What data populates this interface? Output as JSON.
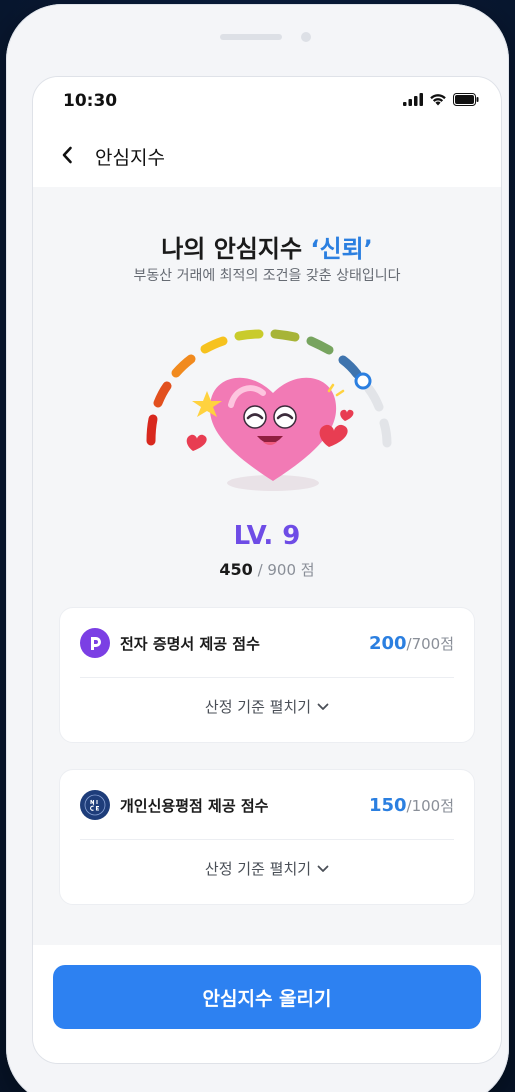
{
  "status_bar": {
    "time": "10:30"
  },
  "header": {
    "title": "안심지수"
  },
  "hero": {
    "title_prefix": "나의 안심지수 ",
    "title_highlight": "‘신뢰’",
    "subtitle": "부동산 거래에 최적의 조건을 갖춘 상태입니다"
  },
  "level": {
    "label": "LV. 9",
    "score": "450",
    "max_text": " / 900 점",
    "score_value": 450,
    "score_max": 900
  },
  "cards": [
    {
      "title": "전자 증명서 제공 점수",
      "score": "200",
      "max_text": "/700점",
      "expand_label": "산정 기준 펼치기",
      "icon": "document-logo-icon",
      "icon_color": "#7b3fe4"
    },
    {
      "title": "개인신용평점 제공 점수",
      "score": "150",
      "max_text": "/100점",
      "expand_label": "산정 기준 펼치기",
      "icon": "nice-logo-icon",
      "icon_color": "#1e3d7a"
    }
  ],
  "cta": {
    "label": "안심지수 올리기",
    "color": "#2d81f1"
  },
  "colors": {
    "accent_blue": "#2b7fe0",
    "level_purple": "#6e4ce6"
  }
}
